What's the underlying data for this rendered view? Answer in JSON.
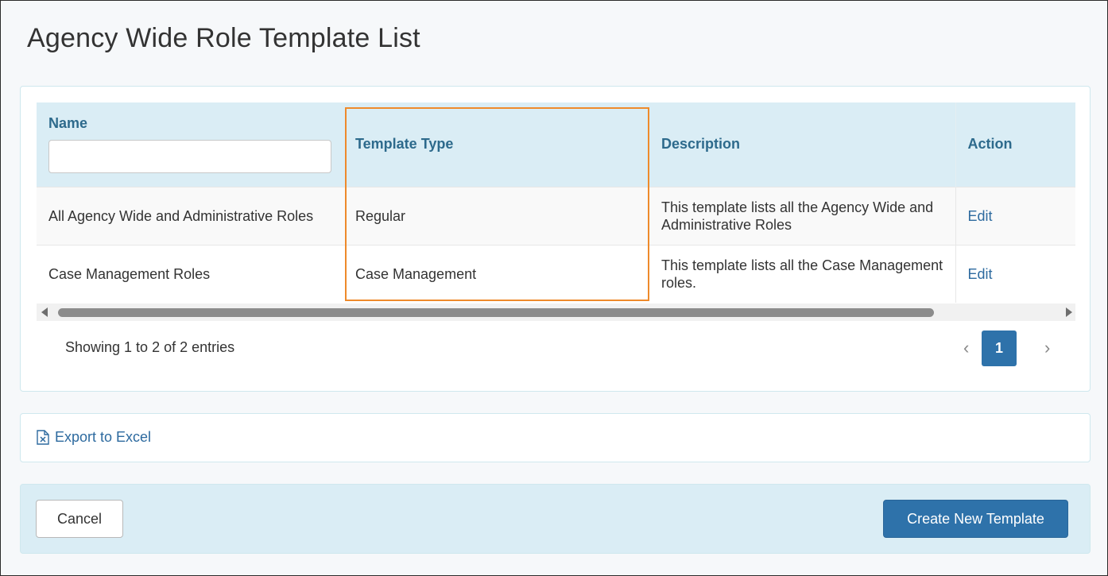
{
  "page": {
    "title": "Agency Wide Role Template List"
  },
  "table": {
    "columns": {
      "name": "Name",
      "template_type": "Template Type",
      "description": "Description",
      "action": "Action"
    },
    "name_filter_value": "",
    "rows": [
      {
        "name": "All Agency Wide and Administrative Roles",
        "template_type": "Regular",
        "description": "This template lists all the Agency Wide and Administrative Roles",
        "action": "Edit"
      },
      {
        "name": "Case Management Roles",
        "template_type": "Case Management",
        "description": "This template lists all the Case Management roles.",
        "action": "Edit"
      }
    ]
  },
  "pagination": {
    "summary": "Showing 1 to 2 of 2 entries",
    "prev_glyph": "‹",
    "current_page": "1",
    "next_glyph": "›"
  },
  "export": {
    "label": "Export to Excel",
    "icon": "excel-file-icon"
  },
  "footer": {
    "cancel_label": "Cancel",
    "create_label": "Create New Template"
  },
  "colors": {
    "accent": "#2e72aa",
    "header_bg": "#daedf5",
    "header_text": "#2d6a8c",
    "highlight": "#ee8a2b"
  }
}
